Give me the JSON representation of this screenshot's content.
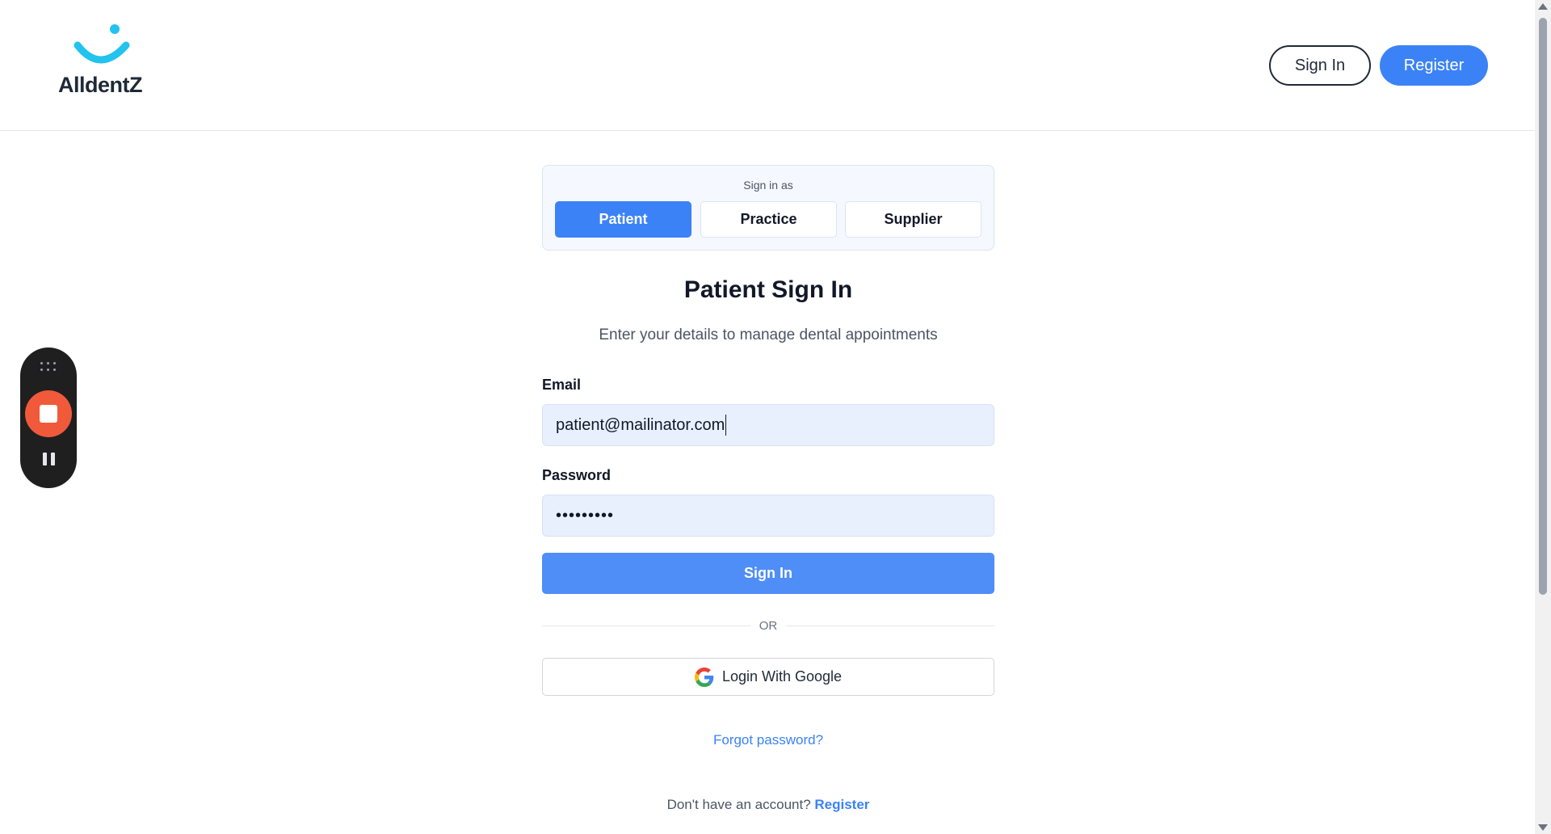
{
  "header": {
    "logo_text": "AlldentZ",
    "sign_in_label": "Sign In",
    "register_label": "Register"
  },
  "role_selector": {
    "caption": "Sign in as",
    "roles": [
      {
        "label": "Patient",
        "selected": true
      },
      {
        "label": "Practice",
        "selected": false
      },
      {
        "label": "Supplier",
        "selected": false
      }
    ]
  },
  "form": {
    "title": "Patient Sign In",
    "subtitle": "Enter your details to manage dental appointments",
    "email_label": "Email",
    "email_value": "patient@mailinator.com",
    "password_label": "Password",
    "password_value": "•••••••••",
    "submit_label": "Sign In",
    "divider_text": "OR",
    "google_label": "Login With Google",
    "forgot_label": "Forgot password?",
    "no_account_text": "Don't have an account?",
    "register_link": "Register"
  },
  "colors": {
    "primary": "#3b82f6",
    "recorder_stop": "#f05a3a"
  },
  "icons": [
    "smile-logo-icon",
    "google-icon",
    "grip-icon",
    "stop-icon",
    "pause-icon"
  ]
}
